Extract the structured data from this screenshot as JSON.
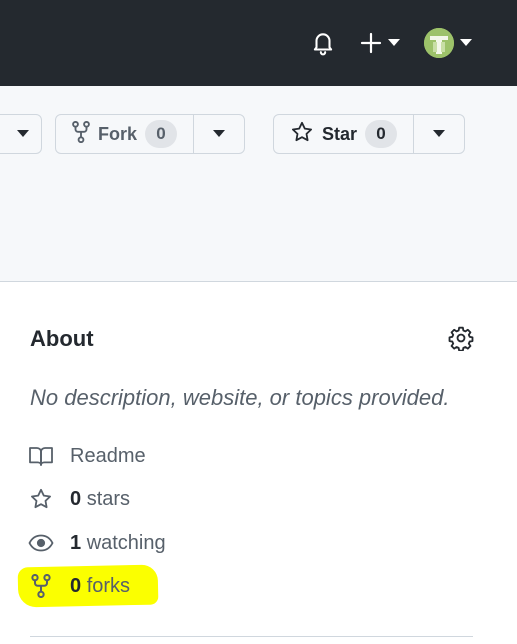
{
  "header": {
    "icons": {
      "notifications": "bell-icon",
      "create": "plus-icon",
      "caret": "triangle-down-icon",
      "avatar": "user-avatar"
    },
    "avatar_color": "#9dc26a"
  },
  "repo_actions": {
    "fork": {
      "label": "Fork",
      "count": "0",
      "icon": "repo-forked-icon"
    },
    "star": {
      "label": "Star",
      "count": "0",
      "icon": "star-icon"
    }
  },
  "about": {
    "title": "About",
    "description": "No description, website, or topics provided.",
    "settings_icon": "gear-icon",
    "readme_label": "Readme",
    "stars": {
      "count": "0",
      "label": "stars"
    },
    "watching": {
      "count": "1",
      "label": "watching"
    },
    "forks": {
      "count": "0",
      "label": "forks"
    }
  },
  "colors": {
    "header_bg": "#24292f",
    "highlight": "#fbff00",
    "muted_text": "#57606a"
  }
}
